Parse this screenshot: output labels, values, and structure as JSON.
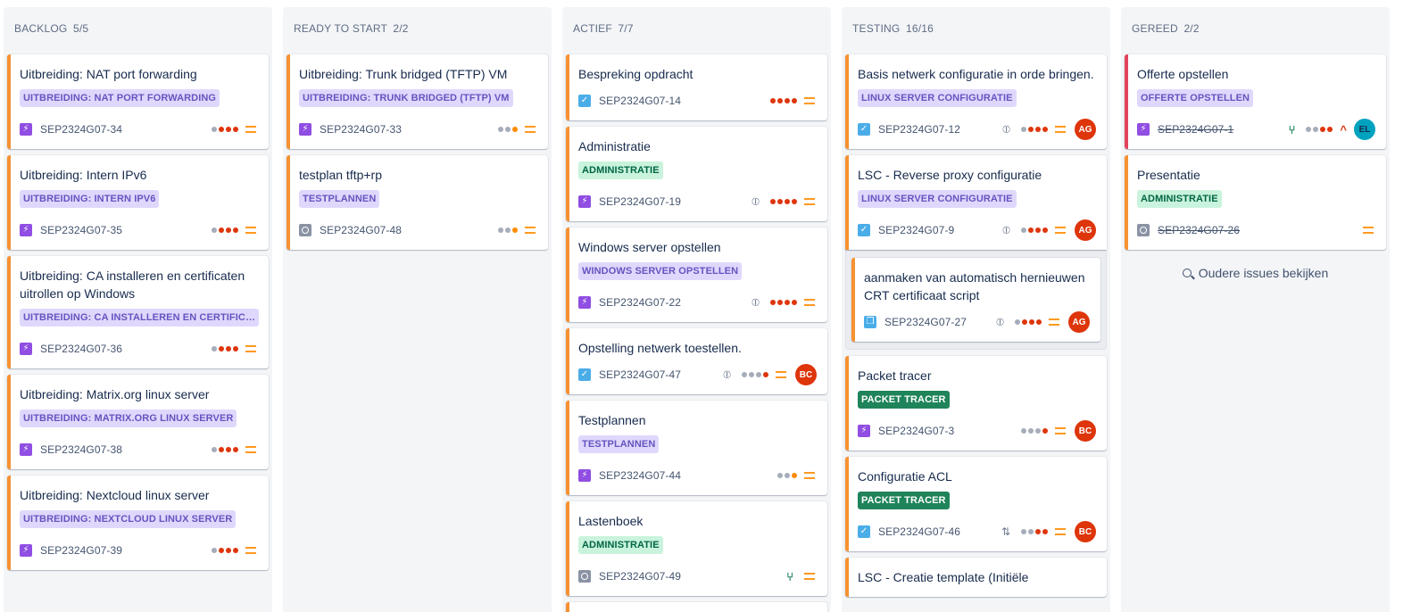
{
  "columns": [
    {
      "title": "BACKLOG",
      "count": "5/5",
      "cards": [
        {
          "title": "Uitbreiding: NAT port forwarding",
          "epic": "UITBREIDING: NAT PORT FORWARDING",
          "key": "SEP2324G07-34"
        },
        {
          "title": "Uitbreiding: Intern IPv6",
          "epic": "UITBREIDING: INTERN IPV6",
          "key": "SEP2324G07-35"
        },
        {
          "title": "Uitbreiding: CA installeren en certificaten uitrollen op Windows",
          "epic": "UITBREIDING: CA INSTALLEREN EN CERTIFICATEN UITROLLEN OP WINDOWS",
          "key": "SEP2324G07-36"
        },
        {
          "title": "Uitbreiding: Matrix.org linux server",
          "epic": "UITBREIDING: MATRIX.ORG LINUX SERVER",
          "key": "SEP2324G07-38"
        },
        {
          "title": "Uitbreiding: Nextcloud linux server",
          "epic": "UITBREIDING: NEXTCLOUD LINUX SERVER",
          "key": "SEP2324G07-39"
        }
      ]
    },
    {
      "title": "READY TO START",
      "count": "2/2",
      "cards": [
        {
          "title": "Uitbreiding: Trunk bridged (TFTP) VM",
          "epic": "UITBREIDING: TRUNK BRIDGED (TFTP) VM",
          "key": "SEP2324G07-33"
        },
        {
          "title": "testplan tftp+rp",
          "epic": "TESTPLANNEN",
          "key": "SEP2324G07-48"
        }
      ]
    },
    {
      "title": "ACTIEF",
      "count": "7/7",
      "cards": [
        {
          "title": "Bespreking opdracht",
          "key": "SEP2324G07-14"
        },
        {
          "title": "Administratie",
          "epic": "ADMINISTRATIE",
          "key": "SEP2324G07-19"
        },
        {
          "title": "Windows server opstellen",
          "epic": "WINDOWS SERVER OPSTELLEN",
          "key": "SEP2324G07-22"
        },
        {
          "title": "Opstelling netwerk toestellen.",
          "key": "SEP2324G07-47",
          "avatar": "BC"
        },
        {
          "title": "Testplannen",
          "epic": "TESTPLANNEN",
          "key": "SEP2324G07-44"
        },
        {
          "title": "Lastenboek",
          "epic": "ADMINISTRATIE",
          "key": "SEP2324G07-49"
        }
      ]
    },
    {
      "title": "TESTING",
      "count": "16/16",
      "cards": [
        {
          "title": "Basis netwerk configuratie in orde bringen.",
          "epic": "LINUX SERVER CONFIGURATIE",
          "key": "SEP2324G07-12",
          "avatar": "AG"
        },
        {
          "title": "LSC - Reverse proxy configuratie",
          "epic": "LINUX SERVER CONFIGURATIE",
          "key": "SEP2324G07-9",
          "avatar": "AG"
        },
        {
          "title": "aanmaken van automatisch hernieuwen CRT certificaat script",
          "key": "SEP2324G07-27",
          "avatar": "AG"
        },
        {
          "title": "Packet tracer",
          "epic": "PACKET TRACER",
          "key": "SEP2324G07-3",
          "avatar": "BC"
        },
        {
          "title": "Configuratie ACL",
          "epic": "PACKET TRACER",
          "key": "SEP2324G07-46",
          "avatar": "BC"
        },
        {
          "title": "LSC - Creatie template (Initiële"
        }
      ]
    },
    {
      "title": "GEREED",
      "count": "2/2",
      "cards": [
        {
          "title": "Offerte opstellen",
          "epic": "OFFERTE OPSTELLEN",
          "key": "SEP2324G07-1",
          "avatar": "EL"
        },
        {
          "title": "Presentatie",
          "epic": "ADMINISTRATIE",
          "key": "SEP2324G07-26"
        }
      ],
      "older_link": "Oudere issues bekijken"
    }
  ],
  "colors": {
    "accent_orange": "#f79232",
    "accent_red": "#e2445c",
    "epic_purple_bg": "#e0d8fc",
    "epic_green_bg": "#c9f3dc",
    "epic_darkgreen_bg": "#1f845a"
  }
}
